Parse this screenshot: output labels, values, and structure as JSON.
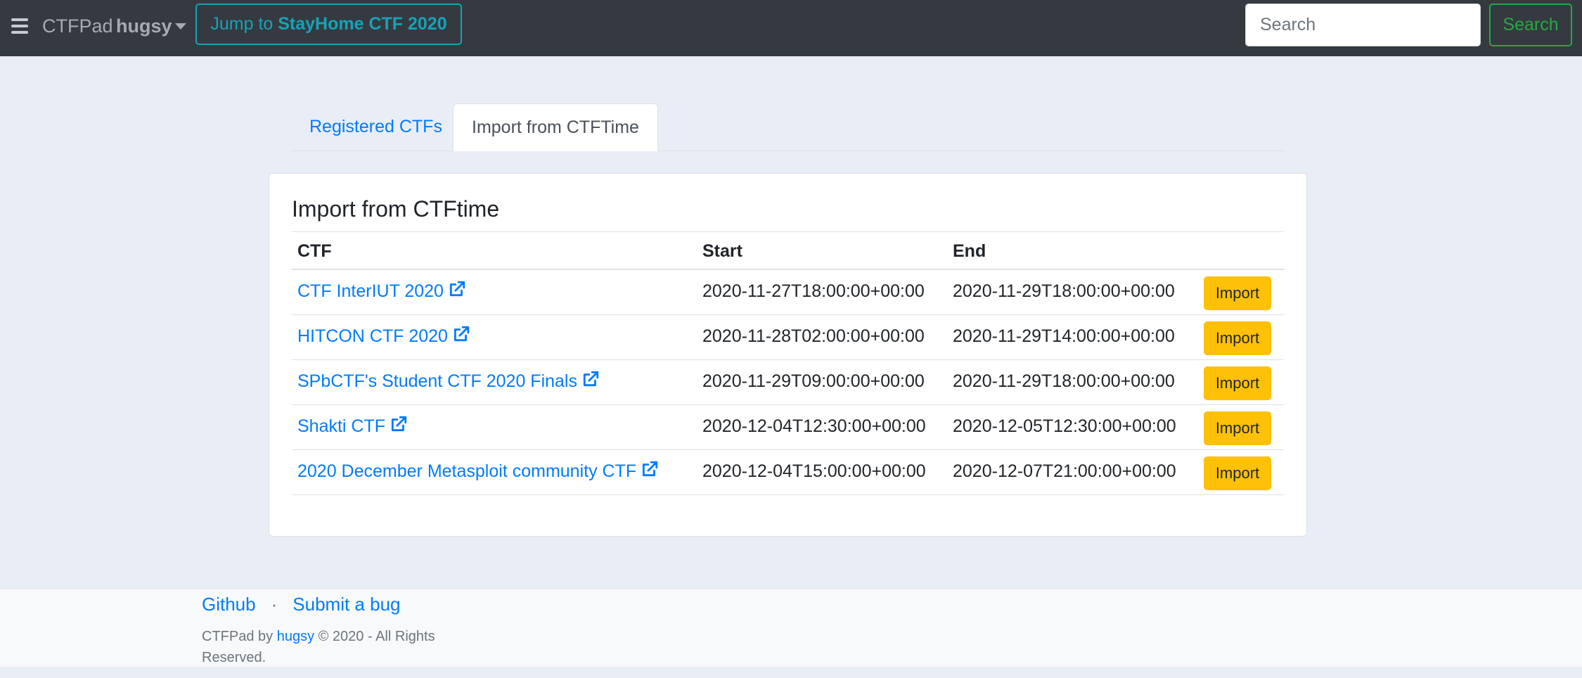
{
  "navbar": {
    "brand": "CTFPad",
    "user": "hugsy",
    "jump_prefix": "Jump to ",
    "jump_target": "StayHome CTF 2020",
    "search_placeholder": "Search",
    "search_button": "Search"
  },
  "tabs": [
    {
      "label": "Registered CTFs",
      "active": false
    },
    {
      "label": "Import from CTFTime",
      "active": true
    }
  ],
  "card": {
    "title": "Import from CTFtime",
    "columns": [
      "CTF",
      "Start",
      "End"
    ],
    "import_label": "Import",
    "rows": [
      {
        "name": "CTF InterIUT 2020",
        "start": "2020-11-27T18:00:00+00:00",
        "end": "2020-11-29T18:00:00+00:00"
      },
      {
        "name": "HITCON CTF 2020",
        "start": "2020-11-28T02:00:00+00:00",
        "end": "2020-11-29T14:00:00+00:00"
      },
      {
        "name": "SPbCTF's Student CTF 2020 Finals",
        "start": "2020-11-29T09:00:00+00:00",
        "end": "2020-11-29T18:00:00+00:00"
      },
      {
        "name": "Shakti CTF",
        "start": "2020-12-04T12:30:00+00:00",
        "end": "2020-12-05T12:30:00+00:00"
      },
      {
        "name": "2020 December Metasploit community CTF",
        "start": "2020-12-04T15:00:00+00:00",
        "end": "2020-12-07T21:00:00+00:00"
      }
    ]
  },
  "footer": {
    "github": "Github",
    "sep": "·",
    "bug": "Submit a bug",
    "copy_prefix": "CTFPad by ",
    "copy_author": "hugsy",
    "copy_suffix": " © 2020 - All Rights Reserved."
  },
  "colors": {
    "navbar_bg": "#343a40",
    "link": "#007bff",
    "info": "#17a2b8",
    "success": "#28a745",
    "warning": "#ffc107"
  },
  "icons": [
    "hamburger-icon",
    "caret-down-icon",
    "external-link-icon"
  ]
}
